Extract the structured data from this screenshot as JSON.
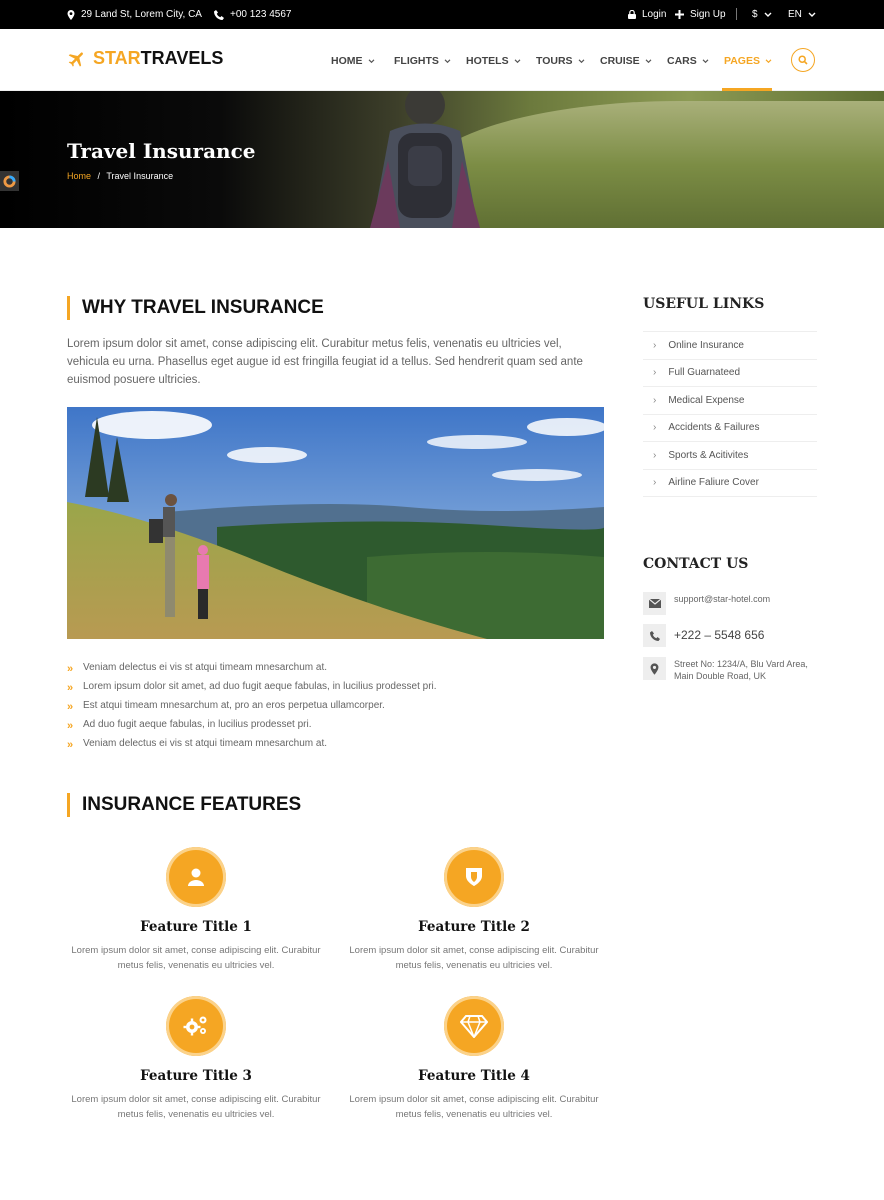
{
  "topbar": {
    "address": "29 Land St, Lorem City, CA",
    "phone": "+00 123 4567",
    "login": "Login",
    "signup": "Sign Up",
    "currency": "$",
    "language": "EN"
  },
  "brand": {
    "part1": "STAR",
    "part2": "TRAVELS",
    "accent": "#f5a623"
  },
  "nav": {
    "items": [
      {
        "label": "HOME"
      },
      {
        "label": "FLIGHTS"
      },
      {
        "label": "HOTELS"
      },
      {
        "label": "TOURS"
      },
      {
        "label": "CRUISE"
      },
      {
        "label": "CARS"
      },
      {
        "label": "PAGES"
      }
    ],
    "active": "PAGES"
  },
  "banner": {
    "title": "Travel Insurance",
    "breadcrumb": {
      "home": "Home",
      "separator": "/",
      "current": "Travel Insurance"
    }
  },
  "why": {
    "heading": "WHY TRAVEL INSURANCE",
    "intro": "Lorem ipsum dolor sit amet, conse adipiscing elit. Curabitur metus felis, venenatis eu ultricies vel, vehicula eu urna. Phasellus eget augue id est fringilla feugiat id a tellus. Sed hendrerit quam sed ante euismod posuere ultricies.",
    "bullets": [
      "Veniam delectus ei vis st atqui timeam mnesarchum at.",
      "Lorem ipsum dolor sit amet, ad duo fugit aeque fabulas, in lucilius prodesset pri.",
      "Est atqui timeam mnesarchum at, pro an eros perpetua ullamcorper.",
      "Ad duo fugit aeque fabulas, in lucilius prodesset pri.",
      "Veniam delectus ei vis st atqui timeam mnesarchum at."
    ]
  },
  "features": {
    "heading": "INSURANCE FEATURES",
    "items": [
      {
        "title": "Feature Title 1",
        "desc": "Lorem ipsum dolor sit amet, conse adipiscing elit. Curabitur metus felis, venenatis eu ultricies vel.",
        "icon": "user-icon"
      },
      {
        "title": "Feature Title 2",
        "desc": "Lorem ipsum dolor sit amet, conse adipiscing elit. Curabitur metus felis, venenatis eu ultricies vel.",
        "icon": "shield-icon"
      },
      {
        "title": "Feature Title 3",
        "desc": "Lorem ipsum dolor sit amet, conse adipiscing elit. Curabitur metus felis, venenatis eu ultricies vel.",
        "icon": "gears-icon"
      },
      {
        "title": "Feature Title 4",
        "desc": "Lorem ipsum dolor sit amet, conse adipiscing elit. Curabitur metus felis, venenatis eu ultricies vel.",
        "icon": "diamond-icon"
      }
    ]
  },
  "sidebar": {
    "links_heading": "USEFUL LINKS",
    "links": [
      "Online Insurance",
      "Full Guarnateed",
      "Medical Expense",
      "Accidents & Failures",
      "Sports & Acitivites",
      "Airline Faliure Cover"
    ],
    "contact_heading": "CONTACT US",
    "email": "support@star-hotel.com",
    "phone": "+222 – 5548 656",
    "address_line1": "Street No: 1234/A, Blu Vard Area,",
    "address_line2": "Main Double Road, UK"
  }
}
